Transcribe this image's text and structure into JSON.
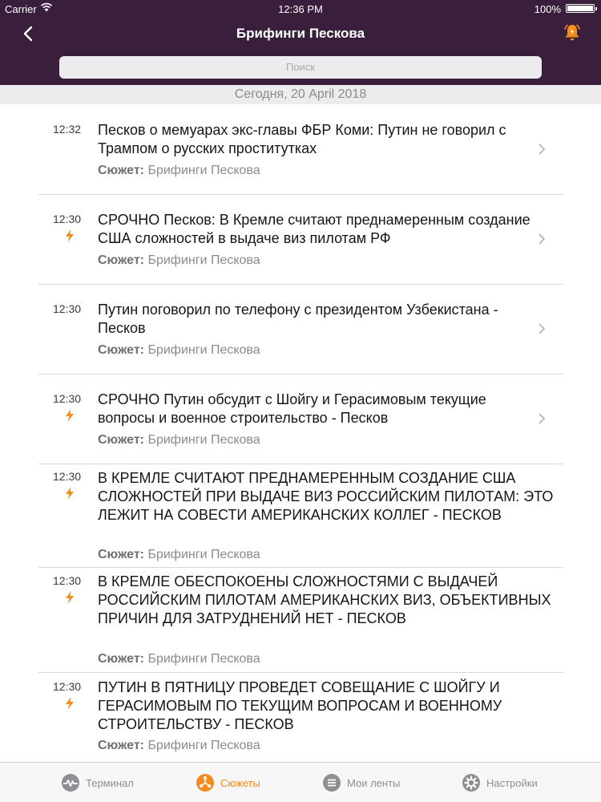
{
  "status_bar": {
    "carrier": "Carrier",
    "time": "12:36 PM",
    "battery": "100%"
  },
  "nav": {
    "title": "Брифинги Пескова"
  },
  "search": {
    "placeholder": "Поиск"
  },
  "date_header": "Сегодня, 20 April 2018",
  "source_label": "Сюжет:",
  "news": [
    {
      "time": "12:32",
      "urgent": false,
      "title": "Песков о мемуарах экс-главы ФБР Коми: Путин не говорил с Трампом о русских проститутках",
      "source": "Брифинги Пескова"
    },
    {
      "time": "12:30",
      "urgent": true,
      "title": "СРОЧНО Песков: В Кремле считают преднамеренным создание США сложностей в выдаче виз пилотам РФ",
      "source": "Брифинги Пескова"
    },
    {
      "time": "12:30",
      "urgent": false,
      "title": "Путин поговорил по телефону с президентом Узбекистана - Песков",
      "source": "Брифинги Пескова"
    },
    {
      "time": "12:30",
      "urgent": true,
      "title": "СРОЧНО Путин обсудит с Шойгу и Герасимовым текущие вопросы и военное строительство - Песков",
      "source": "Брифинги Пескова"
    },
    {
      "time": "12:30",
      "urgent": true,
      "title": "В КРЕМЛЕ СЧИТАЮТ ПРЕДНАМЕРЕННЫМ СОЗДАНИЕ США СЛОЖНОСТЕЙ ПРИ ВЫДАЧЕ ВИЗ РОССИЙСКИМ ПИЛОТАМ: ЭТО ЛЕЖИТ НА СОВЕСТИ АМЕРИКАНСКИХ КОЛЛЕГ - ПЕСКОВ",
      "source": "Брифинги Пескова"
    },
    {
      "time": "12:30",
      "urgent": true,
      "title": "В КРЕМЛЕ ОБЕСПОКОЕНЫ СЛОЖНОСТЯМИ С ВЫДАЧЕЙ РОССИЙСКИМ ПИЛОТАМ АМЕРИКАНСКИХ ВИЗ, ОБЪЕКТИВНЫХ ПРИЧИН ДЛЯ ЗАТРУДНЕНИЙ НЕТ - ПЕСКОВ",
      "source": "Брифинги Пескова"
    },
    {
      "time": "12:30",
      "urgent": true,
      "title": "ПУТИН В ПЯТНИЦУ ПРОВЕДЕТ СОВЕЩАНИЕ С ШОЙГУ И ГЕРАСИМОВЫМ ПО ТЕКУЩИМ ВОПРОСАМ И ВОЕННОМУ СТРОИТЕЛЬСТВУ - ПЕСКОВ",
      "source": "Брифинги Пескова"
    }
  ],
  "tabs": [
    {
      "label": "Терминал",
      "icon": "pulse-icon",
      "active": false
    },
    {
      "label": "Сюжеты",
      "icon": "network-icon",
      "active": true
    },
    {
      "label": "Мои ленты",
      "icon": "list-icon",
      "active": false
    },
    {
      "label": "Настройки",
      "icon": "gear-icon",
      "active": false
    }
  ],
  "colors": {
    "header": "#3a1f3d",
    "accent": "#f28c1e",
    "bolt": "#f28c1e"
  }
}
